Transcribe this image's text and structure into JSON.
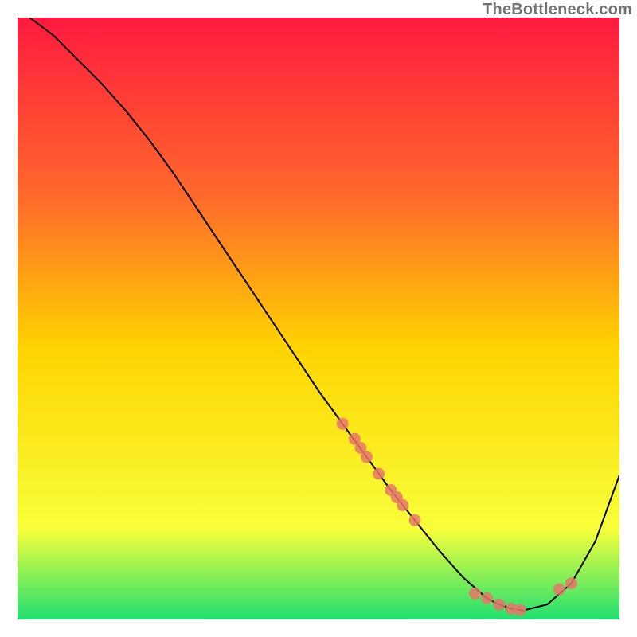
{
  "watermark": "TheBottleneck.com",
  "colors": {
    "gradient_top": "#ff1a3f",
    "gradient_mid_upper": "#ff6a2b",
    "gradient_mid": "#ffd400",
    "gradient_lower": "#f7ff3a",
    "gradient_bottom": "#20e070",
    "frame": "#ffffff",
    "curve": "#000000",
    "marker": "#e8766b"
  },
  "chart_data": {
    "type": "line",
    "title": "",
    "xlabel": "",
    "ylabel": "",
    "xlim": [
      0,
      100
    ],
    "ylim": [
      0,
      100
    ],
    "grid": false,
    "legend": false,
    "series": [
      {
        "name": "bottleneck-curve",
        "x": [
          2,
          6,
          10,
          14,
          18,
          22,
          26,
          30,
          34,
          38,
          42,
          46,
          50,
          54,
          58,
          62,
          66,
          70,
          74,
          78,
          80,
          82,
          84,
          88,
          92,
          96,
          100
        ],
        "values": [
          100,
          97,
          93,
          89,
          84.5,
          79.5,
          74,
          68,
          62,
          56,
          50,
          44,
          38,
          32.5,
          27,
          21.5,
          16.5,
          11.5,
          7,
          3.5,
          2.5,
          1.8,
          1.5,
          2.5,
          6,
          13,
          24
        ]
      }
    ],
    "markers": {
      "name": "highlighted-points",
      "x": [
        54,
        56,
        57,
        58,
        60,
        62,
        63,
        64,
        66,
        76,
        78,
        80,
        82,
        83.5,
        90,
        92
      ],
      "values": [
        32.5,
        30,
        28.5,
        27,
        24.2,
        21.5,
        20.3,
        19,
        16.5,
        4.3,
        3.5,
        2.5,
        1.8,
        1.6,
        5,
        6
      ]
    }
  }
}
